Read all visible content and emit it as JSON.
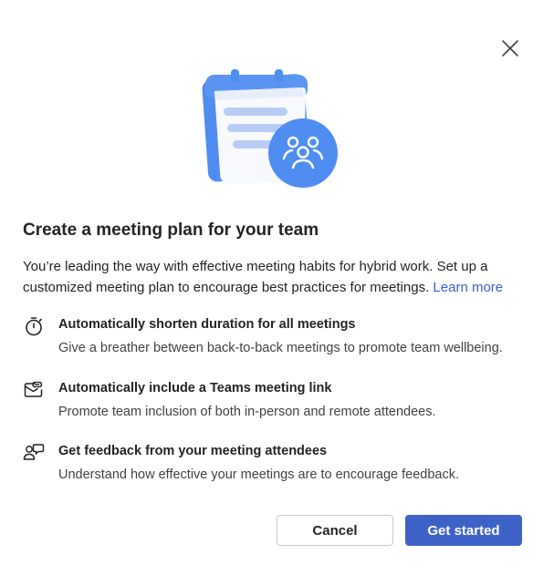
{
  "dialog": {
    "title": "Create a meeting plan for your team",
    "description": "You’re leading the way with effective meeting habits for hybrid work. Set up a customized meeting plan to encourage best practices for meetings.",
    "learn_more": "Learn more",
    "close_icon": "close-icon",
    "hero_icon": "calendar-team-illustration",
    "colors": {
      "accent": "#3e62c8",
      "link": "#3b5fc7",
      "illustration_blue": "#4f8ef0",
      "illustration_light": "#cfe0fb"
    }
  },
  "features": [
    {
      "icon": "timer-icon",
      "heading": "Automatically shorten duration for all meetings",
      "body": "Give a breather between back-to-back meetings to promote team wellbeing."
    },
    {
      "icon": "teams-link-icon",
      "heading": "Automatically include a Teams meeting link",
      "body": "Promote team inclusion of both in-person and remote attendees."
    },
    {
      "icon": "feedback-icon",
      "heading": "Get feedback from your meeting attendees",
      "body": "Understand how effective your meetings are to encourage feedback."
    }
  ],
  "actions": {
    "cancel_label": "Cancel",
    "primary_label": "Get started"
  }
}
